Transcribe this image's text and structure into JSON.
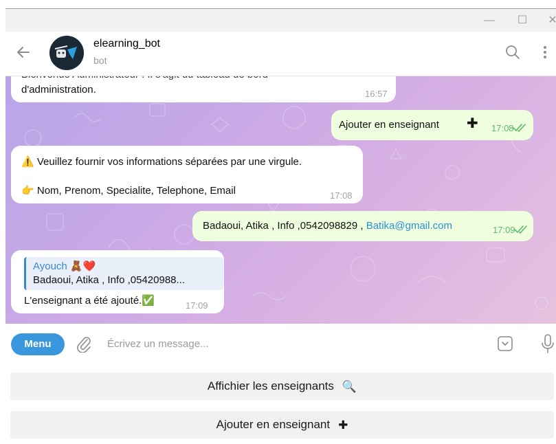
{
  "window": {
    "minimize_glyph": "—",
    "maximize_glyph": "☐",
    "close_glyph": "✕"
  },
  "header": {
    "bot_name": "elearning_bot",
    "bot_status": "bot",
    "icons": [
      "back-arrow-icon",
      "search-icon",
      "more-vertical-icon"
    ]
  },
  "messages": [
    {
      "direction": "in",
      "text_partial": "Bienvenue Administrateur ! Il s'agit du tableau de bord",
      "text": "d'administration.",
      "time": "16:57"
    },
    {
      "direction": "out",
      "text": "Ajouter en enseignant",
      "emoji": "✚",
      "time": "17:08"
    },
    {
      "direction": "in",
      "line1_emoji": "⚠️",
      "line1": "Veuillez fournir vos informations séparées par une virgule.",
      "line2_emoji": "👉",
      "line2": "Nom, Prenom, Specialite, Telephone, Email",
      "time": "17:08"
    },
    {
      "direction": "out",
      "text": "Badaoui, Atika , Info ,0542098829 , ",
      "link": "Batika@gmail.com",
      "time": "17:09"
    },
    {
      "direction": "in",
      "reply_name": "Ayouch 🧸❤️",
      "reply_text": "Badaoui, Atika , Info ,05420988...",
      "text": "L'enseignant a été ajouté.✅",
      "time": "17:09"
    }
  ],
  "composer": {
    "menu_label": "Menu",
    "placeholder": "Écrivez un message..."
  },
  "keyboard": {
    "buttons": [
      {
        "label": "Affichier les enseignants",
        "icon": "🔍"
      },
      {
        "label": "Ajouter en enseignant",
        "icon": "✚"
      }
    ]
  },
  "colors": {
    "accent": "#3a97dd",
    "outgoing_bubble": "#eefedf",
    "read_check": "#5eb86a",
    "link": "#2c8fd6"
  }
}
